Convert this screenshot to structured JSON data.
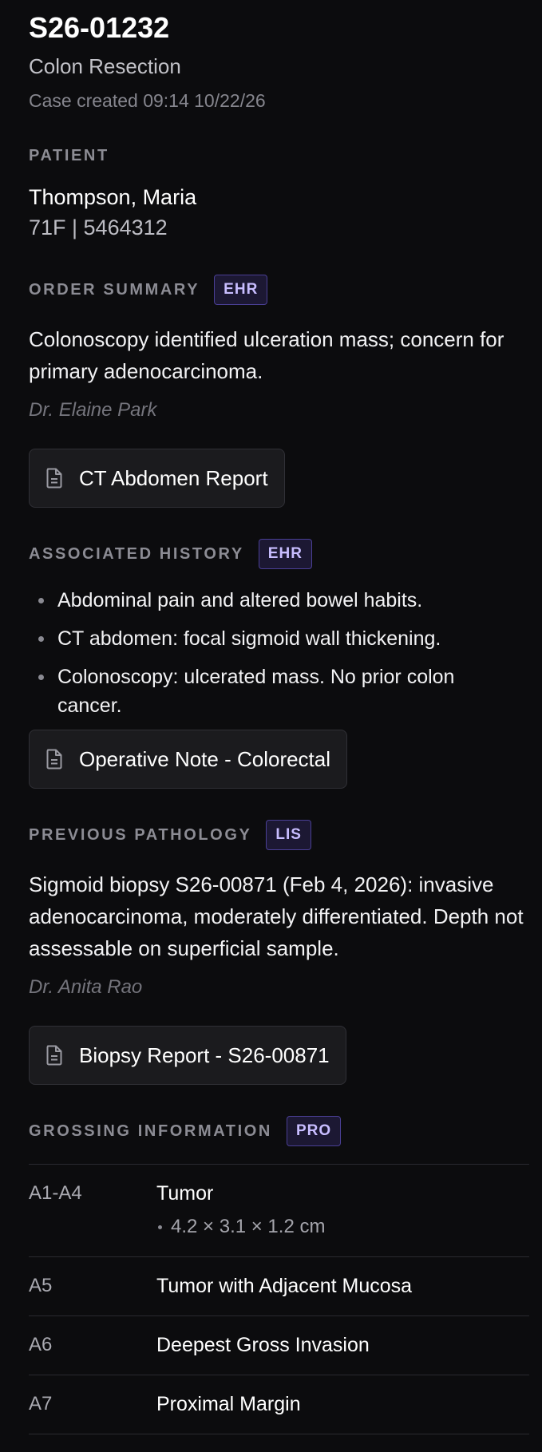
{
  "case": {
    "id": "S26-01232",
    "type": "Colon Resection",
    "created": "Case created 09:14 10/22/26"
  },
  "patient": {
    "label": "PATIENT",
    "name": "Thompson, Maria",
    "meta": "71F | 5464312"
  },
  "order_summary": {
    "label": "ORDER SUMMARY",
    "badge": "EHR",
    "text": "Colonoscopy identified ulceration mass; concern for primary adenocarcinoma.",
    "author": "Dr. Elaine Park",
    "doc_button": "CT Abdomen Report"
  },
  "associated_history": {
    "label": "ASSOCIATED HISTORY",
    "badge": "EHR",
    "items": [
      "Abdominal pain and altered bowel habits.",
      "CT abdomen: focal sigmoid wall thickening.",
      "Colonoscopy: ulcerated mass. No prior colon cancer."
    ],
    "doc_button": "Operative Note - Colorectal"
  },
  "previous_pathology": {
    "label": "PREVIOUS PATHOLOGY",
    "badge": "LIS",
    "text": "Sigmoid biopsy S26-00871 (Feb 4, 2026): invasive adenocarcinoma, moderately differentiated. Depth not assessable on superficial sample.",
    "author": "Dr. Anita Rao",
    "doc_button": "Biopsy Report - S26-00871"
  },
  "grossing": {
    "label": "GROSSING INFORMATION",
    "badge": "PRO",
    "rows": [
      {
        "block": "A1-A4",
        "description": "Tumor",
        "detail": "4.2 × 3.1 × 1.2 cm"
      },
      {
        "block": "A5",
        "description": "Tumor with Adjacent Mucosa"
      },
      {
        "block": "A6",
        "description": "Deepest Gross Invasion"
      },
      {
        "block": "A7",
        "description": "Proximal Margin"
      }
    ]
  },
  "icons": {
    "document": "document-icon"
  },
  "colors": {
    "background": "#0c0c0e",
    "badge_border": "#4a3f95",
    "badge_text": "#c8bdff"
  }
}
